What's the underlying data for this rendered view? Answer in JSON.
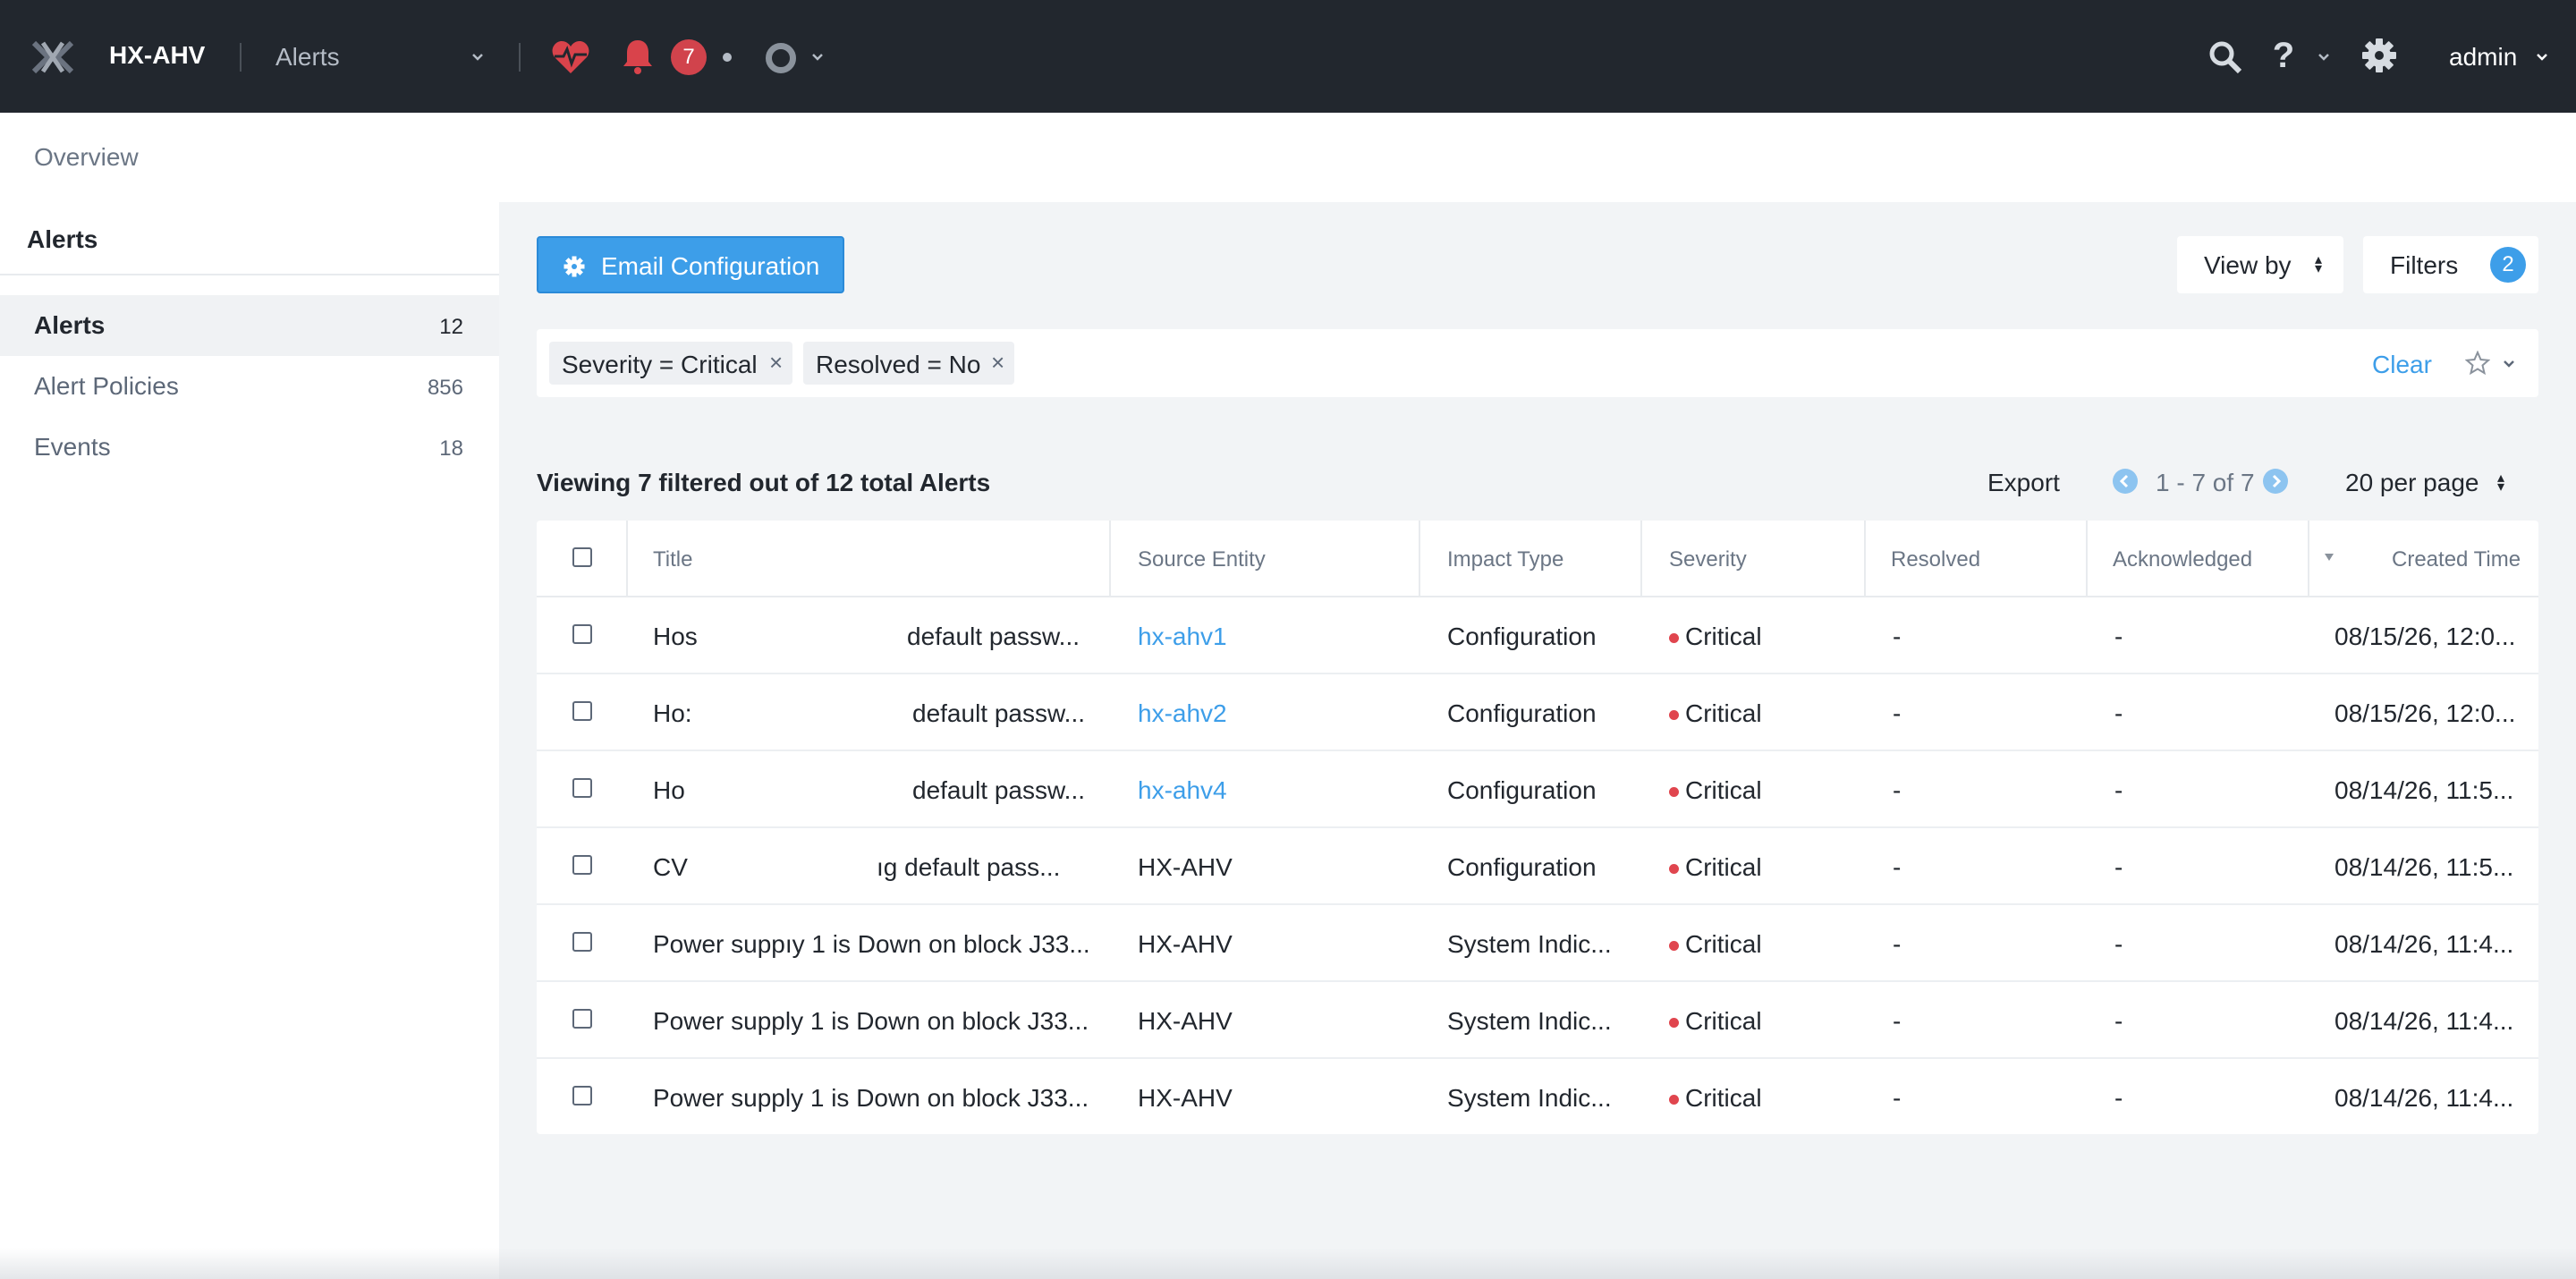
{
  "topbar": {
    "cluster_name": "HX-AHV",
    "page_selector": "Alerts",
    "alert_count": "7",
    "user": "admin"
  },
  "subbar": {
    "overview": "Overview"
  },
  "sidebar": {
    "title": "Alerts",
    "items": [
      {
        "label": "Alerts",
        "count": "12",
        "active": true
      },
      {
        "label": "Alert Policies",
        "count": "856",
        "active": false
      },
      {
        "label": "Events",
        "count": "18",
        "active": false
      }
    ]
  },
  "toolbar": {
    "email_config": "Email Configuration",
    "view_by": "View by",
    "filters": "Filters",
    "filters_count": "2"
  },
  "filter_bar": {
    "chips": [
      "Severity = Critical",
      "Resolved = No"
    ],
    "clear": "Clear"
  },
  "list": {
    "summary": "Viewing 7 filtered out of 12 total Alerts",
    "export": "Export",
    "pagination": "1 - 7 of 7",
    "per_page": "20 per page"
  },
  "table": {
    "columns": [
      "Title",
      "Source Entity",
      "Impact Type",
      "Severity",
      "Resolved",
      "Acknowledged",
      "Created Time"
    ],
    "rows": [
      {
        "title_start": "Hos",
        "title_end": "default passw...",
        "source": "hx-ahv1",
        "source_link": true,
        "impact": "Configuration",
        "severity": "Critical",
        "resolved": "-",
        "acknowledged": "-",
        "created": "08/15/26, 12:0..."
      },
      {
        "title_start": "Ho:",
        "title_end": "default passw...",
        "source": "hx-ahv2",
        "source_link": true,
        "impact": "Configuration",
        "severity": "Critical",
        "resolved": "-",
        "acknowledged": "-",
        "created": "08/15/26, 12:0..."
      },
      {
        "title_start": "Ho",
        "title_end": "default passw...",
        "source": "hx-ahv4",
        "source_link": true,
        "impact": "Configuration",
        "severity": "Critical",
        "resolved": "-",
        "acknowledged": "-",
        "created": "08/14/26, 11:5..."
      },
      {
        "title_start": "CV",
        "title_end": "ıg default pass...",
        "source": "HX-AHV",
        "source_link": false,
        "impact": "Configuration",
        "severity": "Critical",
        "resolved": "-",
        "acknowledged": "-",
        "created": "08/14/26, 11:5..."
      },
      {
        "title_start": "Power suppıy 1 is Down on block J33...",
        "title_end": "",
        "source": "HX-AHV",
        "source_link": false,
        "impact": "System Indic...",
        "severity": "Critical",
        "resolved": "-",
        "acknowledged": "-",
        "created": "08/14/26, 11:4..."
      },
      {
        "title_start": "Power supply 1 is Down on block J33...",
        "title_end": "",
        "source": "HX-AHV",
        "source_link": false,
        "impact": "System Indic...",
        "severity": "Critical",
        "resolved": "-",
        "acknowledged": "-",
        "created": "08/14/26, 11:4..."
      },
      {
        "title_start": "Power supply 1 is Down on block J33...",
        "title_end": "",
        "source": "HX-AHV",
        "source_link": false,
        "impact": "System Indic...",
        "severity": "Critical",
        "resolved": "-",
        "acknowledged": "-",
        "created": "08/14/26, 11:4..."
      }
    ]
  },
  "colors": {
    "topbar_bg": "#22272e",
    "accent_blue": "#3d9ee9",
    "critical_red": "#e0454e",
    "badge_red": "#d1434c"
  },
  "icons": [
    "nutanix-logo-icon",
    "health-heart-icon",
    "bell-icon",
    "task-circle-icon",
    "search-icon",
    "help-icon",
    "gear-icon",
    "star-icon",
    "close-icon",
    "chevron-down-icon",
    "chevron-left-icon",
    "chevron-right-icon"
  ]
}
